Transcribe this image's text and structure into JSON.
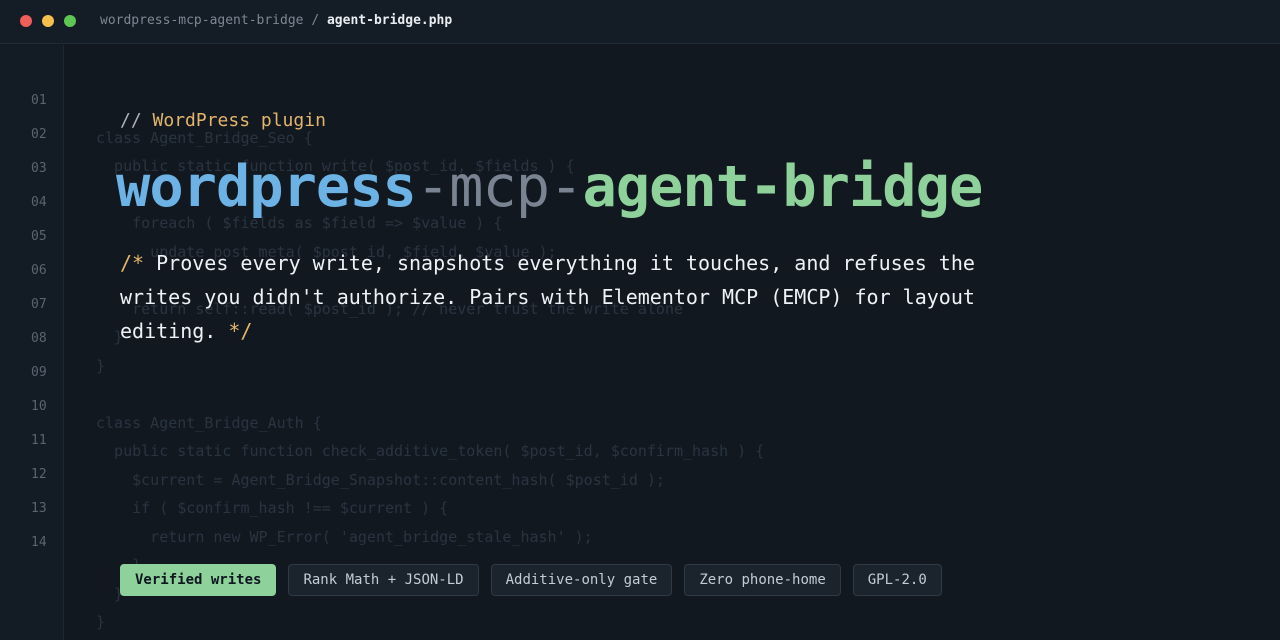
{
  "window": {
    "breadcrumb_repo": "wordpress-mcp-agent-bridge",
    "breadcrumb_sep": " / ",
    "breadcrumb_file": "agent-bridge.php"
  },
  "gutter": {
    "line_numbers": [
      "01",
      "02",
      "03",
      "04",
      "05",
      "06",
      "07",
      "08",
      "09",
      "10",
      "11",
      "12",
      "13",
      "14"
    ]
  },
  "background_code": [
    "class Agent_Bridge_Seo {",
    "  public static function write( $post_id, $fields ) {",
    "    foreach ( $fields as $field => $value ) {",
    "      update_post_meta( $post_id, $field, $value );",
    "    return self::read( $post_id ); // never trust the write alone",
    "  }",
    "}",
    "class Agent_Bridge_Auth {",
    "  public static function check_additive_token( $post_id, $confirm_hash ) {",
    "    $current = Agent_Bridge_Snapshot::content_hash( $post_id );",
    "    if ( $confirm_hash !== $current ) {",
    "      return new WP_Error( 'agent_bridge_stale_hash' );",
    "    }",
    "  }",
    "}"
  ],
  "hero": {
    "comment_slashes": "// ",
    "comment_text": "WordPress plugin",
    "title_part1": "wordpress",
    "title_part2": "-mcp-",
    "title_part3": "agent-bridge",
    "desc_open": "/* ",
    "desc_text": "Proves every write, snapshots everything it touches, and refuses the writes you didn't authorize. Pairs with Elementor MCP (EMCP) for layout editing.",
    "desc_close": " */"
  },
  "badges": [
    "Verified writes",
    "Rank Math + JSON-LD",
    "Additive-only gate",
    "Zero phone-home",
    "GPL-2.0"
  ],
  "colors": {
    "accent_blue": "#6cb2e4",
    "accent_green": "#8ed19b",
    "accent_yellow": "#e3b56d"
  }
}
